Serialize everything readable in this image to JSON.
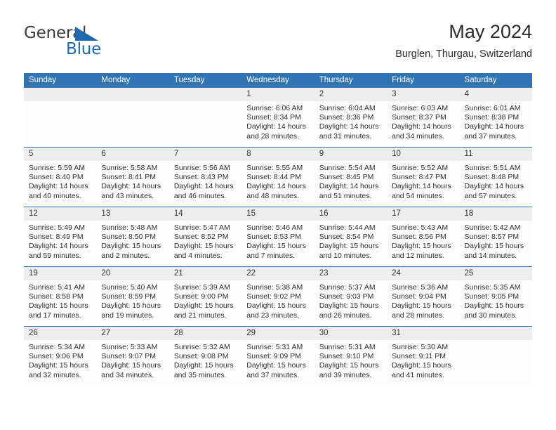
{
  "brand": {
    "line1": "General",
    "line2": "Blue",
    "logo_icon": "triangle-logo-icon",
    "color_primary": "#1e69b0"
  },
  "header": {
    "title": "May 2024",
    "subtitle": "Burglen, Thurgau, Switzerland",
    "accent_color": "#3174b4"
  },
  "calendar": {
    "weekday_headers": [
      "Sunday",
      "Monday",
      "Tuesday",
      "Wednesday",
      "Thursday",
      "Friday",
      "Saturday"
    ],
    "weeks": [
      [
        {
          "day": "",
          "blank": true
        },
        {
          "day": "",
          "blank": true
        },
        {
          "day": "",
          "blank": true
        },
        {
          "day": "1",
          "sunrise": "Sunrise: 6:06 AM",
          "sunset": "Sunset: 8:34 PM",
          "daylight": "Daylight: 14 hours and 28 minutes."
        },
        {
          "day": "2",
          "sunrise": "Sunrise: 6:04 AM",
          "sunset": "Sunset: 8:36 PM",
          "daylight": "Daylight: 14 hours and 31 minutes."
        },
        {
          "day": "3",
          "sunrise": "Sunrise: 6:03 AM",
          "sunset": "Sunset: 8:37 PM",
          "daylight": "Daylight: 14 hours and 34 minutes."
        },
        {
          "day": "4",
          "sunrise": "Sunrise: 6:01 AM",
          "sunset": "Sunset: 8:38 PM",
          "daylight": "Daylight: 14 hours and 37 minutes."
        }
      ],
      [
        {
          "day": "5",
          "sunrise": "Sunrise: 5:59 AM",
          "sunset": "Sunset: 8:40 PM",
          "daylight": "Daylight: 14 hours and 40 minutes."
        },
        {
          "day": "6",
          "sunrise": "Sunrise: 5:58 AM",
          "sunset": "Sunset: 8:41 PM",
          "daylight": "Daylight: 14 hours and 43 minutes."
        },
        {
          "day": "7",
          "sunrise": "Sunrise: 5:56 AM",
          "sunset": "Sunset: 8:43 PM",
          "daylight": "Daylight: 14 hours and 46 minutes."
        },
        {
          "day": "8",
          "sunrise": "Sunrise: 5:55 AM",
          "sunset": "Sunset: 8:44 PM",
          "daylight": "Daylight: 14 hours and 48 minutes."
        },
        {
          "day": "9",
          "sunrise": "Sunrise: 5:54 AM",
          "sunset": "Sunset: 8:45 PM",
          "daylight": "Daylight: 14 hours and 51 minutes."
        },
        {
          "day": "10",
          "sunrise": "Sunrise: 5:52 AM",
          "sunset": "Sunset: 8:47 PM",
          "daylight": "Daylight: 14 hours and 54 minutes."
        },
        {
          "day": "11",
          "sunrise": "Sunrise: 5:51 AM",
          "sunset": "Sunset: 8:48 PM",
          "daylight": "Daylight: 14 hours and 57 minutes."
        }
      ],
      [
        {
          "day": "12",
          "sunrise": "Sunrise: 5:49 AM",
          "sunset": "Sunset: 8:49 PM",
          "daylight": "Daylight: 14 hours and 59 minutes."
        },
        {
          "day": "13",
          "sunrise": "Sunrise: 5:48 AM",
          "sunset": "Sunset: 8:50 PM",
          "daylight": "Daylight: 15 hours and 2 minutes."
        },
        {
          "day": "14",
          "sunrise": "Sunrise: 5:47 AM",
          "sunset": "Sunset: 8:52 PM",
          "daylight": "Daylight: 15 hours and 4 minutes."
        },
        {
          "day": "15",
          "sunrise": "Sunrise: 5:46 AM",
          "sunset": "Sunset: 8:53 PM",
          "daylight": "Daylight: 15 hours and 7 minutes."
        },
        {
          "day": "16",
          "sunrise": "Sunrise: 5:44 AM",
          "sunset": "Sunset: 8:54 PM",
          "daylight": "Daylight: 15 hours and 10 minutes."
        },
        {
          "day": "17",
          "sunrise": "Sunrise: 5:43 AM",
          "sunset": "Sunset: 8:56 PM",
          "daylight": "Daylight: 15 hours and 12 minutes."
        },
        {
          "day": "18",
          "sunrise": "Sunrise: 5:42 AM",
          "sunset": "Sunset: 8:57 PM",
          "daylight": "Daylight: 15 hours and 14 minutes."
        }
      ],
      [
        {
          "day": "19",
          "sunrise": "Sunrise: 5:41 AM",
          "sunset": "Sunset: 8:58 PM",
          "daylight": "Daylight: 15 hours and 17 minutes."
        },
        {
          "day": "20",
          "sunrise": "Sunrise: 5:40 AM",
          "sunset": "Sunset: 8:59 PM",
          "daylight": "Daylight: 15 hours and 19 minutes."
        },
        {
          "day": "21",
          "sunrise": "Sunrise: 5:39 AM",
          "sunset": "Sunset: 9:00 PM",
          "daylight": "Daylight: 15 hours and 21 minutes."
        },
        {
          "day": "22",
          "sunrise": "Sunrise: 5:38 AM",
          "sunset": "Sunset: 9:02 PM",
          "daylight": "Daylight: 15 hours and 23 minutes."
        },
        {
          "day": "23",
          "sunrise": "Sunrise: 5:37 AM",
          "sunset": "Sunset: 9:03 PM",
          "daylight": "Daylight: 15 hours and 26 minutes."
        },
        {
          "day": "24",
          "sunrise": "Sunrise: 5:36 AM",
          "sunset": "Sunset: 9:04 PM",
          "daylight": "Daylight: 15 hours and 28 minutes."
        },
        {
          "day": "25",
          "sunrise": "Sunrise: 5:35 AM",
          "sunset": "Sunset: 9:05 PM",
          "daylight": "Daylight: 15 hours and 30 minutes."
        }
      ],
      [
        {
          "day": "26",
          "sunrise": "Sunrise: 5:34 AM",
          "sunset": "Sunset: 9:06 PM",
          "daylight": "Daylight: 15 hours and 32 minutes."
        },
        {
          "day": "27",
          "sunrise": "Sunrise: 5:33 AM",
          "sunset": "Sunset: 9:07 PM",
          "daylight": "Daylight: 15 hours and 34 minutes."
        },
        {
          "day": "28",
          "sunrise": "Sunrise: 5:32 AM",
          "sunset": "Sunset: 9:08 PM",
          "daylight": "Daylight: 15 hours and 35 minutes."
        },
        {
          "day": "29",
          "sunrise": "Sunrise: 5:31 AM",
          "sunset": "Sunset: 9:09 PM",
          "daylight": "Daylight: 15 hours and 37 minutes."
        },
        {
          "day": "30",
          "sunrise": "Sunrise: 5:31 AM",
          "sunset": "Sunset: 9:10 PM",
          "daylight": "Daylight: 15 hours and 39 minutes."
        },
        {
          "day": "31",
          "sunrise": "Sunrise: 5:30 AM",
          "sunset": "Sunset: 9:11 PM",
          "daylight": "Daylight: 15 hours and 41 minutes."
        },
        {
          "day": "",
          "blank": true
        }
      ]
    ]
  }
}
